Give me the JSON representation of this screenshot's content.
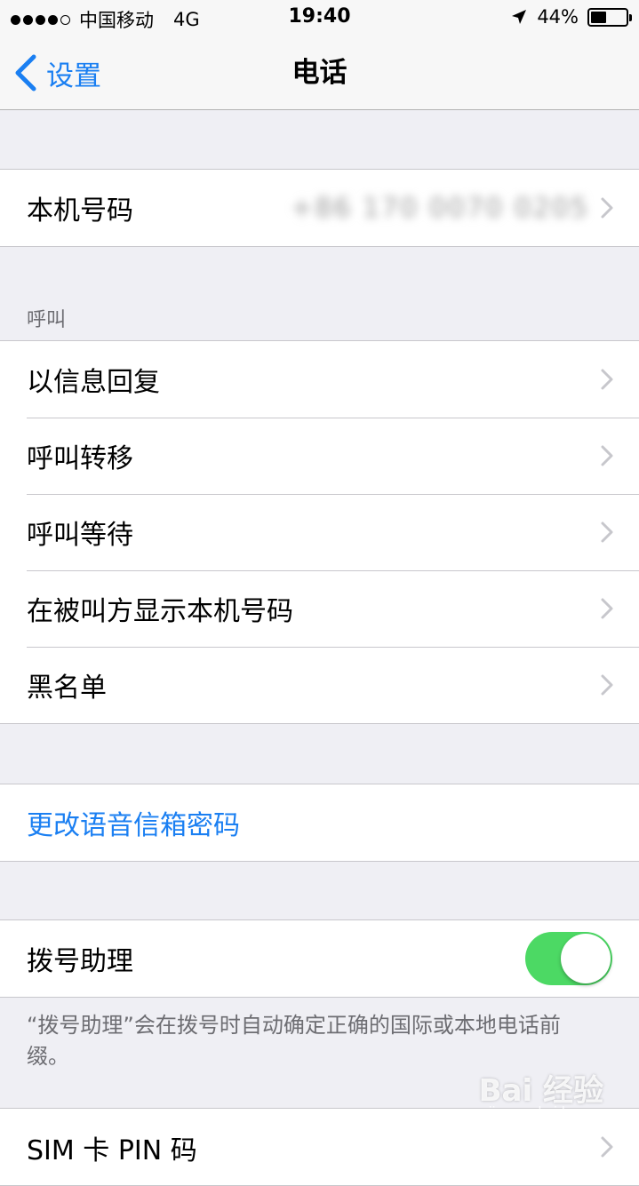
{
  "status_bar": {
    "carrier": "中国移动",
    "network": "4G",
    "time": "19:40",
    "battery_percent": "44%",
    "battery_level": 0.44
  },
  "nav": {
    "back_label": "设置",
    "title": "电话"
  },
  "my_number": {
    "label": "本机号码",
    "value": "+86 170 0070 0205"
  },
  "calls_section": {
    "header": "呼叫",
    "items": [
      {
        "label": "以信息回复"
      },
      {
        "label": "呼叫转移"
      },
      {
        "label": "呼叫等待"
      },
      {
        "label": "在被叫方显示本机号码"
      },
      {
        "label": "黑名单"
      }
    ]
  },
  "voicemail": {
    "label": "更改语音信箱密码"
  },
  "dial_assist": {
    "label": "拨号助理",
    "enabled": true,
    "footer": "“拨号助理”会在拨号时自动确定正确的国际或本地电话前缀。"
  },
  "sim_pin": {
    "label": "SIM 卡 PIN 码"
  },
  "watermark": {
    "text": "Bai 经验",
    "sub": "jingyan.baidu.com"
  },
  "colors": {
    "accent": "#1a7ff2",
    "toggle_on": "#4cd964",
    "background": "#efeff4"
  }
}
